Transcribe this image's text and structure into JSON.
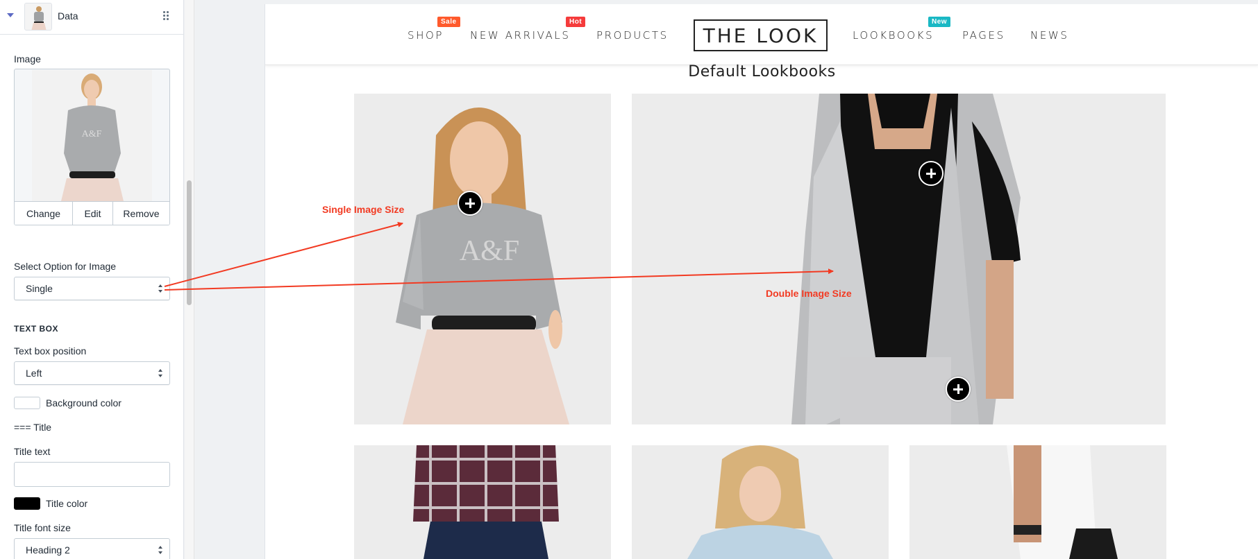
{
  "sidebar": {
    "block_title": "Data",
    "image_label": "Image",
    "image_actions": [
      "Change",
      "Edit",
      "Remove"
    ],
    "select_option_label": "Select Option for Image",
    "select_option_value": "Single",
    "text_box_heading": "TEXT BOX",
    "text_box_position_label": "Text box position",
    "text_box_position_value": "Left",
    "background_color_label": "Background color",
    "title_section": "=== Title",
    "title_text_label": "Title text",
    "title_text_value": "",
    "title_color_label": "Title color",
    "title_font_size_label": "Title font size",
    "title_font_size_value": "Heading 2",
    "colors": {
      "background": "#ffffff",
      "title": "#000000"
    }
  },
  "store": {
    "nav": [
      {
        "label": "SHOP",
        "badge": "Sale",
        "badge_color": "#ff5a2c"
      },
      {
        "label": "NEW ARRIVALS",
        "badge": "Hot",
        "badge_color": "#f53b3b"
      },
      {
        "label": "PRODUCTS",
        "badge": "",
        "badge_color": ""
      },
      {
        "label": "LOOKBOOKS",
        "badge": "New",
        "badge_color": "#1ab8c4"
      },
      {
        "label": "PAGES",
        "badge": "",
        "badge_color": ""
      },
      {
        "label": "NEWS",
        "badge": "",
        "badge_color": ""
      }
    ],
    "logo": "THE LOOK",
    "page_title": "Default Lookbooks"
  },
  "annotations": {
    "single": "Single Image Size",
    "double": "Double Image Size",
    "color": "#f23a22"
  }
}
